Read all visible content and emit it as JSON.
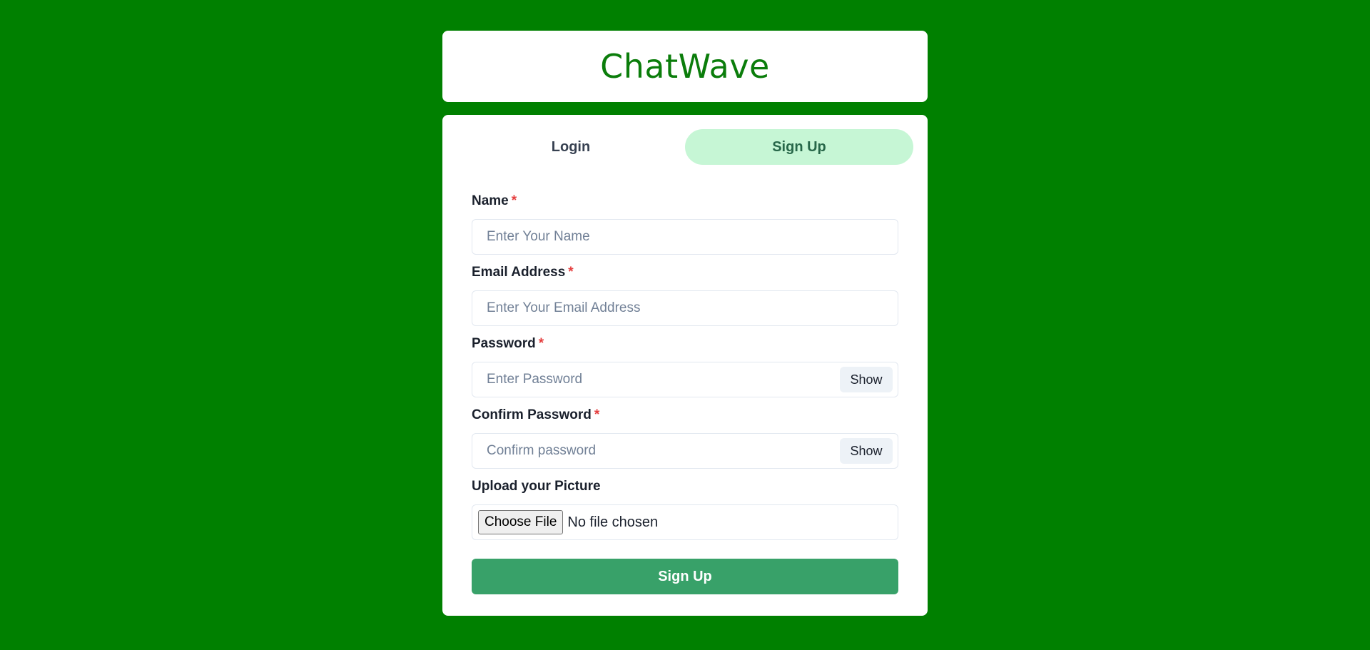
{
  "app": {
    "title": "ChatWave"
  },
  "tabs": [
    {
      "label": "Login",
      "active": false
    },
    {
      "label": "Sign Up",
      "active": true
    }
  ],
  "form": {
    "name": {
      "label": "Name",
      "required_mark": "*",
      "placeholder": "Enter Your Name",
      "value": ""
    },
    "email": {
      "label": "Email Address",
      "required_mark": "*",
      "placeholder": "Enter Your Email Address",
      "value": ""
    },
    "password": {
      "label": "Password",
      "required_mark": "*",
      "placeholder": "Enter Password",
      "value": "",
      "toggle_label": "Show"
    },
    "confirm": {
      "label": "Confirm Password",
      "required_mark": "*",
      "placeholder": "Confirm password",
      "value": "",
      "toggle_label": "Show"
    },
    "picture": {
      "label": "Upload your Picture",
      "button_label": "Choose File",
      "status": "No file chosen"
    },
    "submit_label": "Sign Up"
  },
  "colors": {
    "background": "#008000",
    "brand": "#0b7d0b",
    "active_tab_bg": "#c6f6d5",
    "required": "#e53e3e",
    "submit_bg": "#38a169"
  }
}
